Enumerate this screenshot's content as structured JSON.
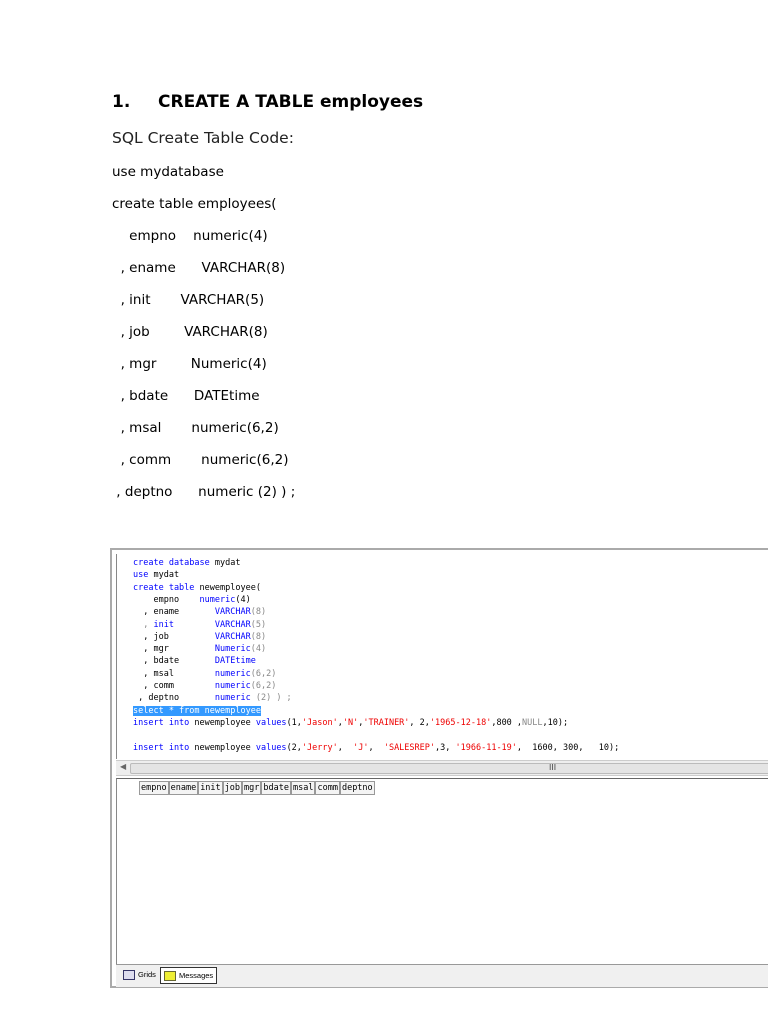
{
  "heading": {
    "number": "1.",
    "text": "CREATE A TABLE employees"
  },
  "subheading": "SQL Create Table Code:",
  "sql_lines": [
    "use mydatabase",
    "create table employees(",
    "    empno    numeric(4)",
    "  , ename      VARCHAR(8)",
    "  , init       VARCHAR(5)",
    "  , job        VARCHAR(8)",
    "  , mgr        Numeric(4)",
    "  , bdate      DATEtime",
    "  , msal       numeric(6,2)",
    "  , comm       numeric(6,2)",
    " , deptno      numeric (2) ) ;"
  ],
  "screenshot": {
    "code": [
      [
        [
          "create database ",
          "#00f"
        ],
        [
          "mydat",
          "#000"
        ]
      ],
      [
        [
          "use ",
          "#00f"
        ],
        [
          "mydat",
          "#000"
        ]
      ],
      [
        [
          "create table ",
          "#00f"
        ],
        [
          "newemployee(",
          "#000"
        ]
      ],
      [
        [
          "    empno    ",
          "#000"
        ],
        [
          "numeric",
          "#00f"
        ],
        [
          "(4)",
          "#000"
        ]
      ],
      [
        [
          "  , ename       ",
          "#000"
        ],
        [
          "VARCHAR",
          "#00f"
        ],
        [
          "(8)",
          "#888"
        ]
      ],
      [
        [
          "  , ",
          "#888"
        ],
        [
          "init        ",
          "#00f"
        ],
        [
          "VARCHAR",
          "#00f"
        ],
        [
          "(5)",
          "#888"
        ]
      ],
      [
        [
          "  , job         ",
          "#000"
        ],
        [
          "VARCHAR",
          "#00f"
        ],
        [
          "(8)",
          "#888"
        ]
      ],
      [
        [
          "  , mgr         ",
          "#000"
        ],
        [
          "Numeric",
          "#00f"
        ],
        [
          "(4)",
          "#888"
        ]
      ],
      [
        [
          "  , bdate       ",
          "#000"
        ],
        [
          "DATEtime",
          "#00f"
        ]
      ],
      [
        [
          "  , msal        ",
          "#000"
        ],
        [
          "numeric",
          "#00f"
        ],
        [
          "(6,2)",
          "#888"
        ]
      ],
      [
        [
          "  , comm        ",
          "#000"
        ],
        [
          "numeric",
          "#00f"
        ],
        [
          "(6,2)",
          "#888"
        ]
      ],
      [
        [
          " , deptno       ",
          "#000"
        ],
        [
          "numeric ",
          "#00f"
        ],
        [
          "(2) ) ;",
          "#888"
        ]
      ],
      [
        [
          "select * from newemployee",
          "sel"
        ]
      ],
      [
        [
          "insert into ",
          "#00f"
        ],
        [
          "newemployee ",
          "#000"
        ],
        [
          "values",
          "#00f"
        ],
        [
          "(1,",
          "#000"
        ],
        [
          "'Jason'",
          "#e00"
        ],
        [
          ",",
          "#000"
        ],
        [
          "'N'",
          "#e00"
        ],
        [
          ",",
          "#000"
        ],
        [
          "'TRAINER'",
          "#e00"
        ],
        [
          ", 2,",
          "#000"
        ],
        [
          "'1965-12-18'",
          "#e00"
        ],
        [
          ",800 ,",
          "#000"
        ],
        [
          "NULL",
          "#888"
        ],
        [
          ",10);",
          "#000"
        ]
      ],
      [
        [
          "",
          "#000"
        ]
      ],
      [
        [
          "insert into ",
          "#00f"
        ],
        [
          "newemployee ",
          "#000"
        ],
        [
          "values",
          "#00f"
        ],
        [
          "(2,",
          "#000"
        ],
        [
          "'Jerry'",
          "#e00"
        ],
        [
          ",  ",
          "#000"
        ],
        [
          "'J'",
          "#e00"
        ],
        [
          ",  ",
          "#000"
        ],
        [
          "'SALESREP'",
          "#e00"
        ],
        [
          ",3, ",
          "#000"
        ],
        [
          "'1966-11-19'",
          "#e00"
        ],
        [
          ",  1600, 300,   10);",
          "#000"
        ]
      ]
    ],
    "scroll_grip": "III",
    "grid_columns": [
      "empno",
      "ename",
      "init",
      "job",
      "mgr",
      "bdate",
      "msal",
      "comm",
      "deptno"
    ],
    "tabs": {
      "grids": "Grids",
      "messages": "Messages"
    }
  }
}
